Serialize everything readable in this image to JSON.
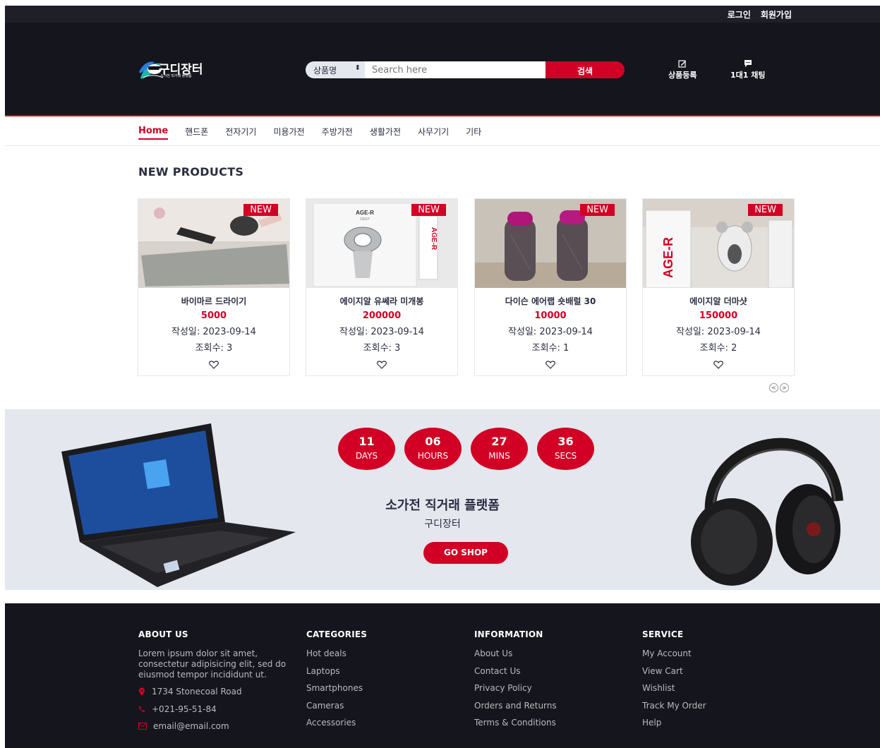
{
  "top_bar": {
    "login": "로그인",
    "signup": "회원가입"
  },
  "header": {
    "logo_text": "구디장터",
    "logo_tagline": "소가전 직거래 플랫폼",
    "search_select": "상품명",
    "search_placeholder": "Search here",
    "search_button": "검색",
    "register_label": "상품등록",
    "chat_label": "1대1 채팅"
  },
  "nav": [
    "Home",
    "핸드폰",
    "전자기기",
    "미용가전",
    "주방가전",
    "생활가전",
    "사무기기",
    "기타"
  ],
  "section_title": "NEW PRODUCTS",
  "products": [
    {
      "badge": "NEW",
      "name": "바이마르 드라이기",
      "price": "5000",
      "date": "작성일: 2023-09-14",
      "views": "조회수: 3"
    },
    {
      "badge": "NEW",
      "name": "에이지알 유쎄라 미개봉",
      "price": "200000",
      "date": "작성일: 2023-09-14",
      "views": "조회수: 3"
    },
    {
      "badge": "NEW",
      "name": "다이슨 에어랩 숏배럴 30",
      "price": "10000",
      "date": "작성일: 2023-09-14",
      "views": "조회수: 1"
    },
    {
      "badge": "NEW",
      "name": "에이지알 더마샷",
      "price": "150000",
      "date": "작성일: 2023-09-14",
      "views": "조회수: 2"
    }
  ],
  "product_images": {
    "p2_box": "AGE-R",
    "p2_box_sub": "DEEP",
    "p2_side": "AGE-R",
    "p4_box": "AGE-R"
  },
  "hot_deal": {
    "countdown": [
      {
        "num": "11",
        "unit": "DAYS"
      },
      {
        "num": "06",
        "unit": "HOURS"
      },
      {
        "num": "27",
        "unit": "MINS"
      },
      {
        "num": "36",
        "unit": "SECS"
      }
    ],
    "title": "소가전 직거래 플랫폼",
    "subtitle": "구디장터",
    "button": "GO SHOP"
  },
  "footer": {
    "about": {
      "title": "ABOUT US",
      "text": "Lorem ipsum dolor sit amet, consectetur adipisicing elit, sed do eiusmod tempor incididunt ut.",
      "address": "1734 Stonecoal Road",
      "phone": "+021-95-51-84",
      "email": "email@email.com"
    },
    "categories": {
      "title": "CATEGORIES",
      "items": [
        "Hot deals",
        "Laptops",
        "Smartphones",
        "Cameras",
        "Accessories"
      ]
    },
    "information": {
      "title": "INFORMATION",
      "items": [
        "About Us",
        "Contact Us",
        "Privacy Policy",
        "Orders and Returns",
        "Terms & Conditions"
      ]
    },
    "service": {
      "title": "SERVICE",
      "items": [
        "My Account",
        "View Cart",
        "Wishlist",
        "Track My Order",
        "Help"
      ]
    }
  },
  "colors": {
    "accent": "#d10024",
    "dark": "#15161d",
    "topbar": "#1e1f29",
    "light_bg": "#e4e7ed",
    "text": "#2b2d42"
  }
}
